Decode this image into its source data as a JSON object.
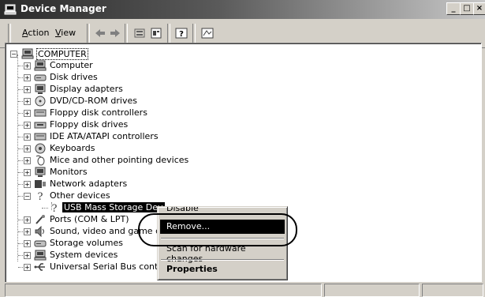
{
  "window": {
    "title": "Device Manager",
    "controls": {
      "minimize": "_",
      "maximize": "□",
      "close": "×"
    }
  },
  "menubar": {
    "items": [
      {
        "label": "Action",
        "accel": "A"
      },
      {
        "label": "View",
        "accel": "V"
      }
    ]
  },
  "toolbar": {
    "tools": [
      "back-icon",
      "forward-icon",
      "up-icon",
      "properties-icon",
      "help-icon",
      "scan-icon"
    ]
  },
  "tree": {
    "root": {
      "label": "COMPUTER",
      "icon": "computer-icon"
    },
    "children": [
      {
        "label": "Computer",
        "icon": "computer-icon"
      },
      {
        "label": "Disk drives",
        "icon": "disk-drive-icon"
      },
      {
        "label": "Display adapters",
        "icon": "monitor-icon"
      },
      {
        "label": "DVD/CD-ROM drives",
        "icon": "cdrom-icon"
      },
      {
        "label": "Floppy disk controllers",
        "icon": "controller-icon"
      },
      {
        "label": "Floppy disk drives",
        "icon": "floppy-icon"
      },
      {
        "label": "IDE ATA/ATAPI controllers",
        "icon": "controller-icon"
      },
      {
        "label": "Keyboards",
        "icon": "keyboard-icon"
      },
      {
        "label": "Mice and other pointing devices",
        "icon": "mouse-icon"
      },
      {
        "label": "Monitors",
        "icon": "monitor-icon"
      },
      {
        "label": "Network adapters",
        "icon": "network-icon"
      },
      {
        "label": "Other devices",
        "icon": "question-icon",
        "expanded": true
      },
      {
        "label": "USB Mass Storage Dev",
        "icon": "question-icon",
        "selected": true
      },
      {
        "label": "Ports (COM & LPT)",
        "icon": "port-icon"
      },
      {
        "label": "Sound, video and game co",
        "icon": "sound-icon"
      },
      {
        "label": "Storage volumes",
        "icon": "disk-drive-icon"
      },
      {
        "label": "System devices",
        "icon": "computer-icon"
      },
      {
        "label": "Universal Serial Bus contro",
        "icon": "usb-icon"
      }
    ]
  },
  "context_menu": {
    "items": [
      {
        "label": "Disable"
      },
      {
        "label": "Remove...",
        "highlighted": true
      },
      {
        "label": "Scan for hardware changes"
      },
      {
        "label": "Properties",
        "bold": true
      }
    ]
  },
  "colors": {
    "face": "#d4d0c8",
    "titlebar_dark": "#2a2a2a",
    "selection": "#000000"
  }
}
